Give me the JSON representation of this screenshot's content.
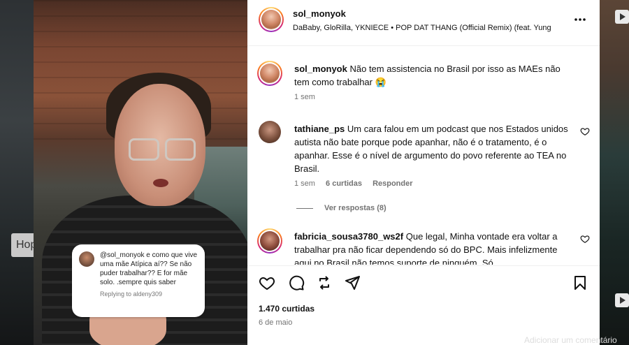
{
  "background": {
    "left_tag": "Hop",
    "right_bottom_text": "Adicionar um comentário"
  },
  "reel": {
    "reply_sticker": {
      "text": "@sol_monyok e como que vive uma mãe Atípica aí?? Se não puder trabalhar?? E for  mãe solo. .sempre quis saber",
      "meta": "Replying to aldeny309"
    }
  },
  "post": {
    "username": "sol_monyok",
    "audio": "DaBaby, GloRilla, YKNIECE • POP DAT THANG (Official Remix) (feat. Yung",
    "more_icon": "more-horizontal-icon"
  },
  "comments": [
    {
      "user": "sol_monyok",
      "text": "Não tem assistencia no Brasil por isso as MAEs não tem como trabalhar 😭",
      "time": "1 sem"
    },
    {
      "user": "tathiane_ps",
      "text": "Um cara falou em um podcast que nos Estados unidos autista não bate porque pode apanhar, não é o tratamento, é o apanhar. Esse é o nível de argumento do povo referente ao TEA no Brasil.",
      "time": "1 sem",
      "likes": "6 curtidas",
      "reply": "Responder",
      "view_replies": "Ver respostas (8)"
    },
    {
      "user": "fabricia_sousa3780_ws2f",
      "text": "Que legal, Minha vontade era voltar a trabalhar pra não ficar dependendo só do BPC. Mais infelizmente aqui no Brasil não temos suporte de ninguém. Só"
    }
  ],
  "actions": {
    "icons": [
      "heart-icon",
      "comment-icon",
      "share-icon",
      "send-icon",
      "bookmark-icon"
    ],
    "likes": "1.470 curtidas",
    "date": "6 de maio"
  },
  "colors": {
    "text": "#111111",
    "muted": "#737373",
    "divider": "#efefef"
  }
}
